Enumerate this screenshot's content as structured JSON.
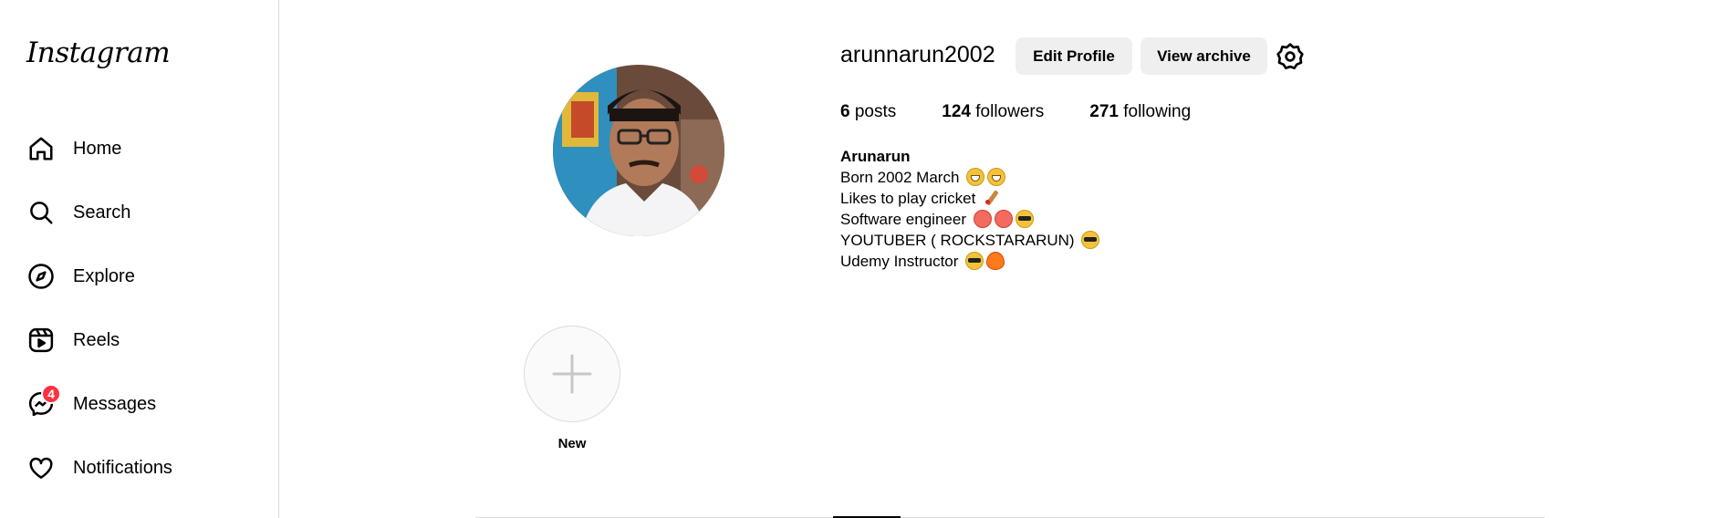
{
  "sidebar": {
    "logo": "Instagram",
    "items": [
      {
        "label": "Home",
        "icon": "home-icon"
      },
      {
        "label": "Search",
        "icon": "search-icon"
      },
      {
        "label": "Explore",
        "icon": "compass-icon"
      },
      {
        "label": "Reels",
        "icon": "reels-icon"
      },
      {
        "label": "Messages",
        "icon": "messenger-icon",
        "badge": "4"
      },
      {
        "label": "Notifications",
        "icon": "heart-icon"
      }
    ]
  },
  "profile": {
    "username": "arunnarun2002",
    "edit_label": "Edit Profile",
    "archive_label": "View archive",
    "settings_icon": "gear-icon",
    "stats": {
      "posts_count": "6",
      "posts_label": "posts",
      "followers_count": "124",
      "followers_label": "followers",
      "following_count": "271",
      "following_label": "following"
    },
    "bio": {
      "name": "Arunarun",
      "lines": [
        {
          "text": "Born 2002 March",
          "emojis": [
            "grin",
            "grin"
          ]
        },
        {
          "text": "Likes to play cricket",
          "emojis": [
            "bat"
          ]
        },
        {
          "text": "Software engineer",
          "emojis": [
            "love",
            "love",
            "cool"
          ]
        },
        {
          "text": "YOUTUBER ( ROCKSTARARUN)",
          "emojis": [
            "cool"
          ]
        },
        {
          "text": "Udemy Instructor",
          "emojis": [
            "cool",
            "fire"
          ]
        }
      ]
    }
  },
  "highlights": {
    "new_label": "New",
    "icon": "plus-icon"
  },
  "colors": {
    "badge": "#ff3040",
    "button_bg": "#efefef",
    "border": "#dbdbdb"
  }
}
